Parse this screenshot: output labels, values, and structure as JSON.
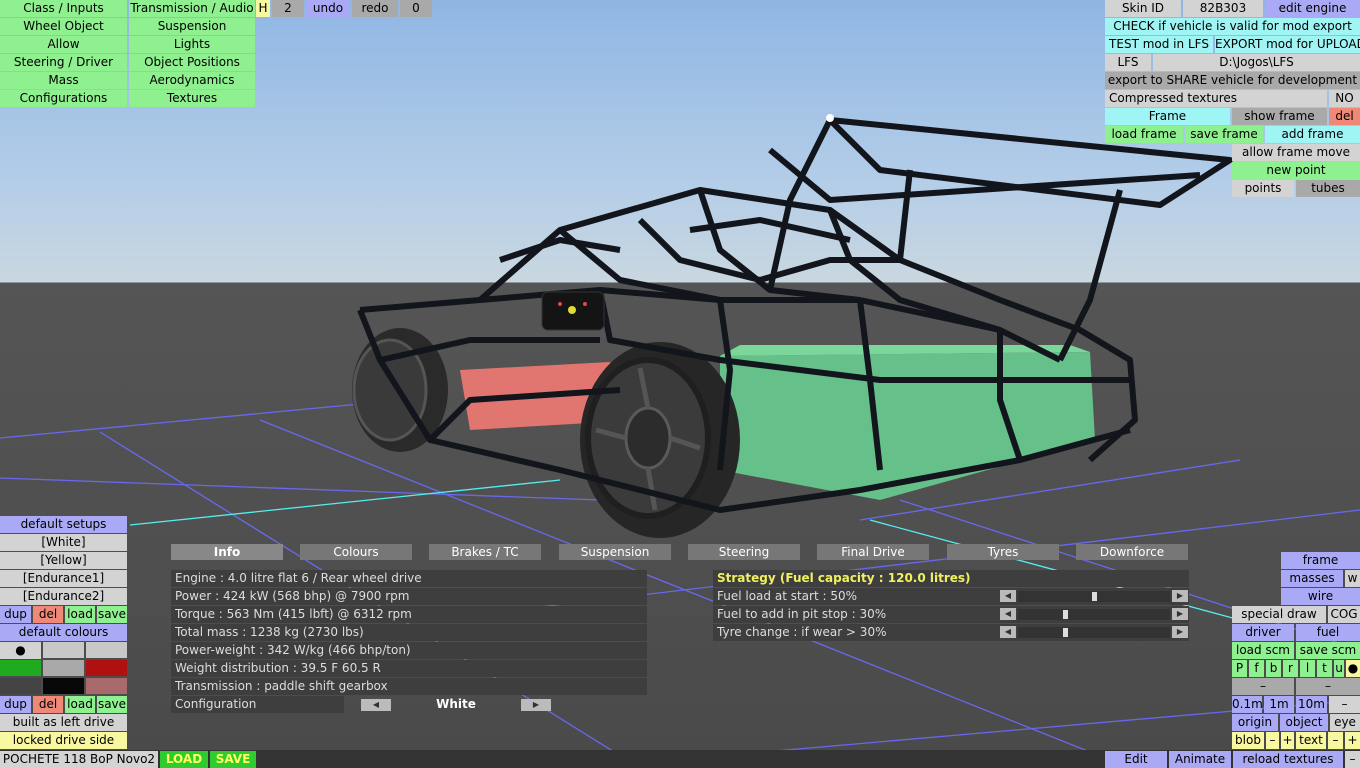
{
  "top_menu": {
    "left_col": [
      "Class / Inputs",
      "Wheel Object",
      "Allow",
      "Steering / Driver",
      "Mass",
      "Configurations"
    ],
    "right_col": [
      "Transmission / Audio",
      "Suspension",
      "Lights",
      "Object Positions",
      "Aerodynamics",
      "Textures"
    ],
    "h_label": "H",
    "count": "2",
    "undo": "undo",
    "redo": "redo",
    "redo_count": "0"
  },
  "top_right": {
    "skin_id_label": "Skin ID",
    "skin_id": "82B303",
    "edit_engine": "edit engine",
    "check_valid": "CHECK if vehicle is valid for mod export",
    "test_mod": "TEST mod in LFS",
    "export_mod": "EXPORT mod for UPLOAD",
    "lfs_label": "LFS",
    "lfs_path": "D:\\Jogos\\LFS",
    "export_share": "export to SHARE vehicle for development",
    "compressed_label": "Compressed textures",
    "compressed_value": "NO",
    "frame": "Frame",
    "show_frame": "show frame",
    "del": "del",
    "load_frame": "load frame",
    "save_frame": "save frame",
    "add_frame": "add frame",
    "allow_frame_move": "allow frame move",
    "new_point": "new point",
    "points": "points",
    "tubes": "tubes"
  },
  "left_panel": {
    "default_setups": "default setups",
    "setups": [
      "[White]",
      "[Yellow]",
      "[Endurance1]",
      "[Endurance2]"
    ],
    "dup": "dup",
    "del": "del",
    "load": "load",
    "save": "save",
    "default_colours": "default colours",
    "dot": "●",
    "dup2": "dup",
    "del2": "del",
    "load2": "load",
    "save2": "save",
    "built_as": "built as left drive",
    "locked_side": "locked drive side"
  },
  "tabs": [
    "Info",
    "Colours",
    "Brakes / TC",
    "Suspension",
    "Steering",
    "Final Drive",
    "Tyres",
    "Downforce"
  ],
  "info": [
    "Engine : 4.0 litre flat 6 / Rear wheel drive",
    "Power : 424 kW (568 bhp) @ 7900 rpm",
    "Torque : 563 Nm (415 lbft) @ 6312 rpm",
    "Total mass : 1238 kg (2730 lbs)",
    "Power-weight : 342 W/kg (466 bhp/ton)",
    "Weight distribution : 39.5 F  60.5 R",
    "Transmission : paddle shift gearbox"
  ],
  "configuration_label": "Configuration",
  "configuration_value": "White",
  "strategy": {
    "title": "Strategy (Fuel capacity : 120.0 litres)",
    "rows": [
      {
        "label": "Fuel load at start : 50%",
        "value": 0.5
      },
      {
        "label": "Fuel to add in pit stop : 30%",
        "value": 0.3
      },
      {
        "label": "Tyre change : if wear > 30%",
        "value": 0.3
      }
    ]
  },
  "bottom_right": {
    "frame": "frame",
    "masses": "masses",
    "w": "w",
    "wire": "wire",
    "special_draw": "special draw",
    "cog": "COG",
    "driver": "driver",
    "fuel": "fuel",
    "load_scm": "load scm",
    "save_scm": "save scm",
    "letters": [
      "P",
      "f",
      "b",
      "r",
      "l",
      "t",
      "u"
    ],
    "dot": "●",
    "minus1": "–",
    "minus2": "–",
    "steps": [
      "0.1m",
      "1m",
      "10m",
      "–"
    ],
    "origin": "origin",
    "object": "object",
    "eye": "eye",
    "blob": "blob",
    "text": "text",
    "plus": "+",
    "minus": "–",
    "edit": "Edit",
    "animate": "Animate",
    "reload_textures": "reload textures"
  },
  "status": {
    "car_name": "POCHETE 118 BoP Novo2",
    "load": "LOAD",
    "save": "SAVE"
  },
  "colors": {
    "green_btn": "#8ff08f",
    "cyan_btn": "#9ff4f4",
    "blue_btn": "#a9a9f5",
    "red_btn": "#f08878"
  }
}
